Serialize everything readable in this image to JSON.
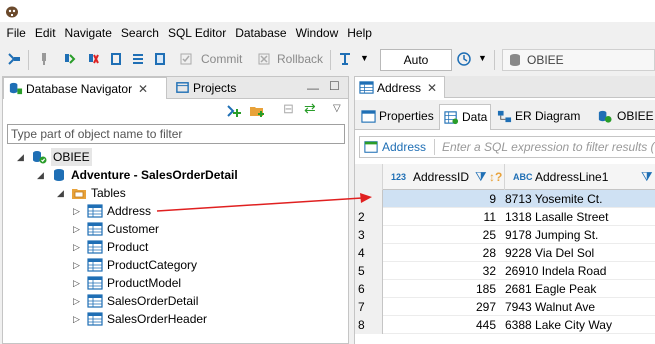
{
  "menu": [
    "File",
    "Edit",
    "Navigate",
    "Search",
    "SQL Editor",
    "Database",
    "Window",
    "Help"
  ],
  "toolbar": {
    "commit_label": "Commit",
    "rollback_label": "Rollback",
    "mode_value": "Auto",
    "datasource_value": "OBIEE"
  },
  "left_panel": {
    "tabs": [
      {
        "label": "Database Navigator"
      },
      {
        "label": "Projects"
      }
    ],
    "filter_placeholder": "Type part of object name to filter",
    "tree": {
      "root": "OBIEE",
      "connection": "Adventure - SalesOrderDetail",
      "folder": "Tables",
      "tables": [
        "Address",
        "Customer",
        "Product",
        "ProductCategory",
        "ProductModel",
        "SalesOrderDetail",
        "SalesOrderHeader"
      ]
    }
  },
  "right_panel": {
    "editor_tab": "Address",
    "subtabs": [
      "Properties",
      "Data",
      "ER Diagram",
      "OBIEE"
    ],
    "filter": {
      "table_name": "Address",
      "placeholder": "Enter a SQL expression to filter results (use"
    },
    "columns": [
      {
        "type_prefix": "123",
        "name": "AddressID"
      },
      {
        "type_prefix": "ABC",
        "name": "AddressLine1"
      }
    ],
    "rows": [
      {
        "num": "",
        "id": "9",
        "addr": "8713 Yosemite Ct."
      },
      {
        "num": "2",
        "id": "11",
        "addr": "1318 Lasalle Street"
      },
      {
        "num": "3",
        "id": "25",
        "addr": "9178 Jumping St."
      },
      {
        "num": "4",
        "id": "28",
        "addr": "9228 Via Del Sol"
      },
      {
        "num": "5",
        "id": "32",
        "addr": "26910 Indela Road"
      },
      {
        "num": "6",
        "id": "185",
        "addr": "2681 Eagle Peak"
      },
      {
        "num": "7",
        "id": "297",
        "addr": "7943 Walnut Ave"
      },
      {
        "num": "8",
        "id": "445",
        "addr": "6388 Lake City Way"
      }
    ]
  },
  "colors": {
    "accent_blue": "#1f6fb5",
    "selection": "#cfe1f3",
    "annotation_arrow": "#e02020"
  }
}
